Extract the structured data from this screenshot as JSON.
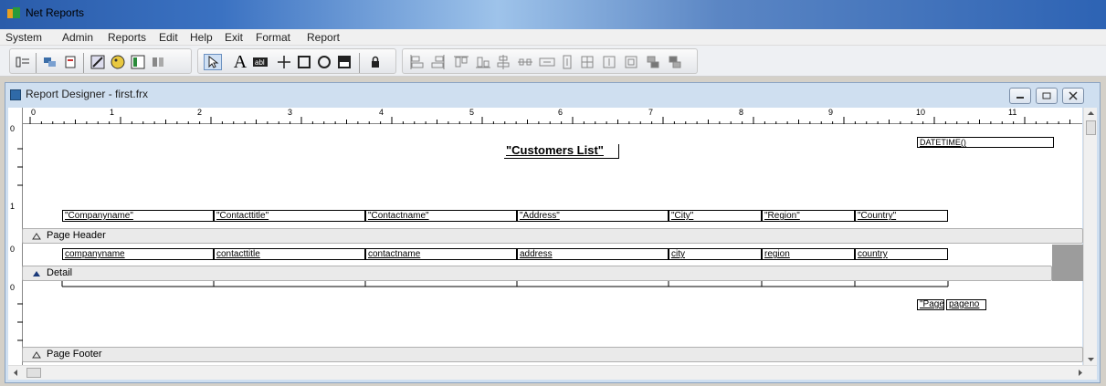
{
  "app": {
    "title": "Net Reports"
  },
  "menubar": {
    "items": [
      "System",
      "Admin",
      "Reports",
      "Edit",
      "Help",
      "Exit",
      "Format",
      "Report"
    ]
  },
  "child_window": {
    "title": "Report Designer - first.frx"
  },
  "ruler": {
    "numbers": [
      "0",
      "1",
      "2",
      "3",
      "4",
      "5",
      "6",
      "7",
      "8",
      "9",
      "10",
      "11"
    ]
  },
  "vruler": {
    "page_header": [
      "0",
      "1"
    ],
    "detail": [
      "0"
    ],
    "footer": [
      "0"
    ]
  },
  "bands": {
    "page_header": "Page Header",
    "detail": "Detail",
    "page_footer": "Page Footer"
  },
  "page_header_fields": {
    "title": "\"Customers List\"",
    "datetime": "DATETIME()",
    "columns": [
      "\"Companyname\"",
      "\"Contacttitle\"",
      "\"Contactname\"",
      "\"Address\"",
      "\"City\"",
      "\"Region\"",
      "\"Country\""
    ]
  },
  "detail_fields": [
    "companyname",
    "contacttitle",
    "contactname",
    "address",
    "city",
    "region",
    "country"
  ],
  "footer_fields": {
    "page_label": "\"Page\"",
    "pageno": "pageno"
  },
  "icons": {
    "app": "reports-icon",
    "child": "designer-icon",
    "minimize": "minimize-icon",
    "restore": "restore-icon",
    "close": "close-icon"
  }
}
